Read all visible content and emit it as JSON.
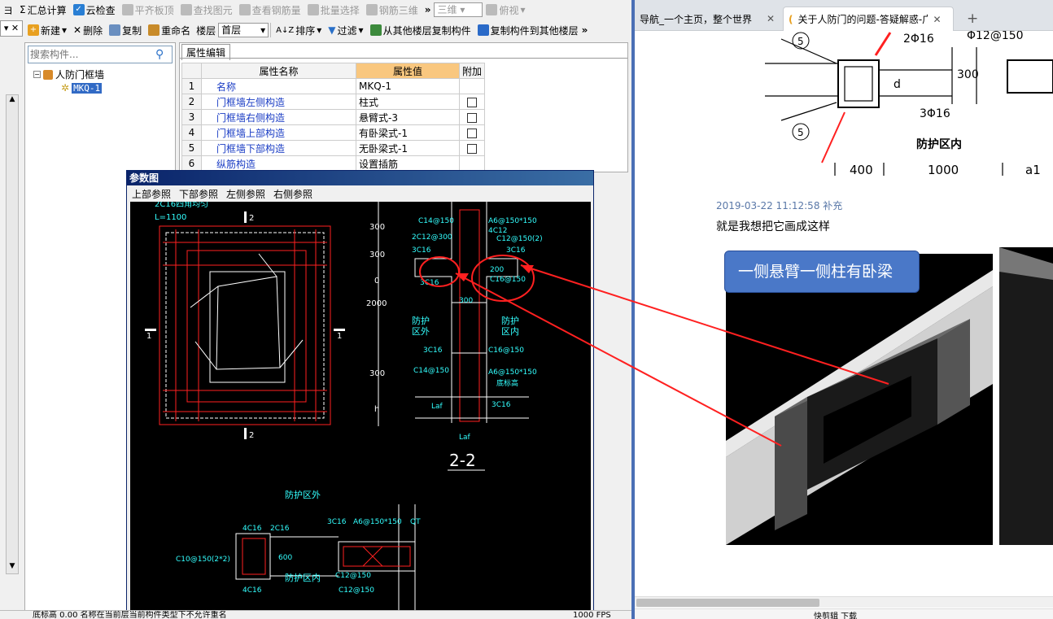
{
  "toolbar1": {
    "sigma": "Σ",
    "items": [
      "汇总计算",
      "云检查",
      "平齐板顶",
      "查找图元",
      "查看钢筋量",
      "批量选择",
      "钢筋三维"
    ],
    "more": "»",
    "view_3d": "三维",
    "view_top": "俯视"
  },
  "toolbar2": {
    "items": [
      "新建",
      "删除",
      "复制",
      "重命名"
    ],
    "floor_label": "楼层",
    "floor_value": "首层",
    "sort": "排序",
    "filter": "过滤",
    "copy_from": "从其他楼层复制构件",
    "copy_to": "复制构件到其他楼层",
    "more": "»"
  },
  "left_panel": {
    "search_placeholder": "搜索构件...",
    "tree_root": "人防门框墙",
    "tree_child": "MKQ-1"
  },
  "property": {
    "tab": "属性编辑",
    "headers": [
      "属性名称",
      "属性值",
      "附加"
    ],
    "rows": [
      {
        "n": "1",
        "name": "名称",
        "value": "MKQ-1",
        "check": false
      },
      {
        "n": "2",
        "name": "门框墙左侧构造",
        "value": "柱式",
        "check": true
      },
      {
        "n": "3",
        "name": "门框墙右侧构造",
        "value": "悬臂式-3",
        "check": true
      },
      {
        "n": "4",
        "name": "门框墙上部构造",
        "value": "有卧梁式-1",
        "check": true
      },
      {
        "n": "5",
        "name": "门框墙下部构造",
        "value": "无卧梁式-1",
        "check": true
      },
      {
        "n": "6",
        "name": "纵筋构造",
        "value": "设置插筋",
        "check": false
      }
    ]
  },
  "dialog": {
    "title": "参数图",
    "menu": [
      "上部参照",
      "下部参照",
      "左侧参照",
      "右侧参照"
    ],
    "labels": {
      "top_note": "2C16四角均匀",
      "l_value": "L=1100",
      "sec2": "2",
      "sec1": "1",
      "d300a": "300",
      "d300b": "300",
      "d0": "0",
      "d2000": "2000",
      "d300c": "300",
      "dh": "h",
      "r1": "C14@150",
      "r2": "2C12@300",
      "r3": "3C16",
      "r4": "3C16",
      "r5": "A6@150*150",
      "r6": "4C12",
      "r7": "C12@150(2)",
      "r8": "3C16",
      "r9": "200",
      "r10": "C16@150",
      "r11": "300",
      "zone_out": "防护\n区外",
      "zone_in": "防护\n区内",
      "r12": "3C16",
      "r13": "C16@150",
      "r14": "C14@150",
      "r15": "A6@150*150",
      "r16": "底标高",
      "r17": "Laf",
      "r18": "3C16",
      "r19": "Laf",
      "section": "2-2",
      "b_zone_out": "防护区外",
      "b1": "4C16",
      "b2": "2C16",
      "b3": "3C16",
      "b4": "A6@150*150",
      "b5": "QT",
      "b6": "C10@150(2*2)",
      "b7": "600",
      "b8": "4C16",
      "b9": "防护区内",
      "b10": "C12@150",
      "b11": "C12@150"
    }
  },
  "statusbar": {
    "text": "底标高 0.00   名称在当前层当前构件类型下不允许重名",
    "right": "1000 FPS"
  },
  "browser": {
    "tab1": "导航_一个主页，整个世界",
    "tab2": "关于人防门的问题-答疑解惑-广联",
    "top_labels": {
      "c1": "5",
      "c2": "5",
      "t1": "2Φ16",
      "t2": "Φ12@150",
      "t3": "300",
      "t4": "d",
      "t5": "3Φ16",
      "t6": "防护区内",
      "t7": "400",
      "t8": "1000",
      "t9": "a1"
    },
    "post_meta": "2019-03-22 11:12:58 补充",
    "post_text": "就是我想把它画成这样",
    "callout": "一侧悬臂一侧柱有卧梁",
    "bottom_status": "快剪辑    下载"
  },
  "colors": {
    "accent": "#0a246a",
    "grid_header": "#f9c77f",
    "link": "#1a3cc4",
    "cad_red": "#ff2020",
    "cad_green": "#22ff22",
    "cad_cyan": "#33ffff",
    "callout": "#4a78c8"
  }
}
